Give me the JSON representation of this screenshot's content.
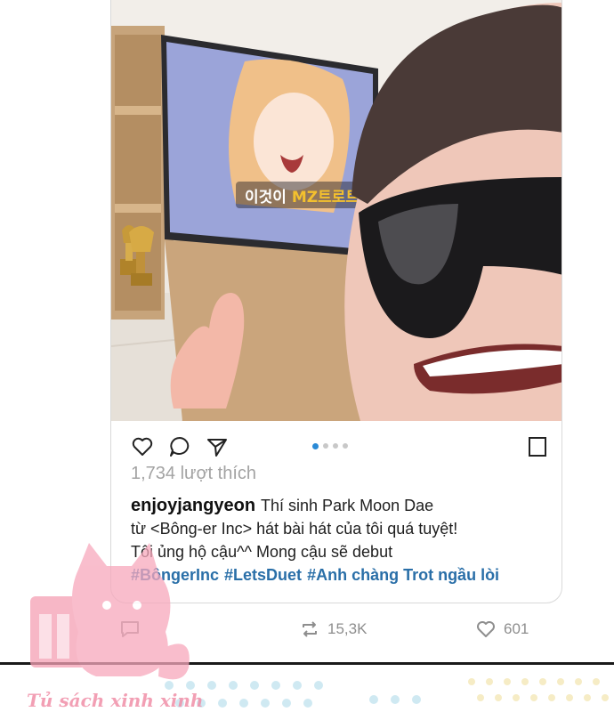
{
  "post": {
    "likes": "1,734 lượt thích",
    "username": "enjoyjangyeon",
    "caption_lines": [
      "Thí sinh Park Moon Dae",
      "từ <Bông-er Inc> hát bài hát của tôi quá tuyệt!",
      "Tôi ủng hộ cậu^^ Mong cậu sẽ debut"
    ],
    "hashtags": [
      "#BôngerInc",
      "#LetsDuet",
      "#Anh chàng Trot ngầu lòi"
    ],
    "carousel": {
      "total": 4,
      "active": 1
    },
    "tv_caption_prefix": "이것이 ",
    "tv_caption_highlight": "MZ트로트"
  },
  "actions": {
    "like_icon": "heart-outline-icon",
    "comment_icon": "speech-bubble-icon",
    "share_icon": "paper-plane-icon",
    "save_icon": "bookmark-icon"
  },
  "footer": {
    "comment_icon": "comment-icon",
    "repost_icon": "repost-icon",
    "repost_count": "15,3K",
    "like_icon": "heart-icon",
    "like_count": "601"
  },
  "watermark": {
    "text": "Tủ sách xinh xinh"
  },
  "colors": {
    "hashtag": "#2a6fa8",
    "likes_text": "#a3a3a3",
    "dot_active": "#2a8ad6",
    "watermark_pink": "#f08fa8"
  }
}
